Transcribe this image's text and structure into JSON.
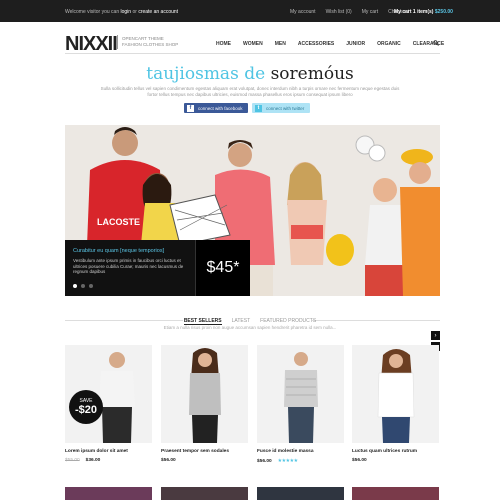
{
  "topbar": {
    "welcome_prefix": "Welcome visitor you can",
    "login": "login",
    "or": "or",
    "create": "create an account",
    "links": [
      "My account",
      "Wish list (0)",
      "My cart",
      "Checkout"
    ],
    "cart_label": "My cart",
    "cart_items": "1 item(s)",
    "cart_amount": "$250.00"
  },
  "header": {
    "logo": "NIXXII",
    "tagline_1": "OPENCART THEME",
    "tagline_2": "FASHION CLOTHES SHOP",
    "nav": [
      "HOME",
      "WOMEN",
      "MEN",
      "ACCESSORIES",
      "JUNIOR",
      "ORGANIC",
      "CLEARANCE"
    ]
  },
  "intro": {
    "title_1": "taujiosmas de",
    "title_2": "soremóus",
    "subtitle": "Sulla sollicitudin tellus vel sapien condimentum egestas aliquam erat volutpat, donec interdum nibh a turpis ornare nec fermentum neque egestas duis fortor tellus tempus nec dapibus ultricies, euismod massa phasellus eros ipsum consequat ipsum libero",
    "facebook_btn": "connect with facebook",
    "twitter_btn": "connect with twitter"
  },
  "slider": {
    "caption_title": "Curabitur eu quam [neque temporios]",
    "caption_text": "Vestibulum ante ipsum primis in faucibus orci luctus et ultrices posuere cubilia Curae; mauris nec lacusmus de regnum dapibus",
    "price": "$45*",
    "brand_mark": "LACOSTE",
    "dots": 3,
    "active_dot": 1
  },
  "products_section": {
    "tabs": [
      "BEST SELLERS",
      "LATEST",
      "FEATURED PRODUCTS"
    ],
    "active_tab": 0,
    "subtitle": "Etiam a nulla risus proin non augue accumsan sapien hendrerit pharetra id sem nulla..."
  },
  "products": [
    {
      "name": "Lorem ipsum dolor sit amet",
      "old_price": "$55.00",
      "price": "$36.00",
      "sale_label": "SAVE",
      "sale_value": "-$20",
      "shirt": "#f4f4f4",
      "pants": "#2b2b2b"
    },
    {
      "name": "Praesent tempor sem sodales",
      "old_price": "",
      "price": "$56.00",
      "shirt": "#bfbfbf",
      "pants": "#222222"
    },
    {
      "name": "Fusce id molestie massa",
      "old_price": "",
      "price": "$56.00",
      "rating": "★★★★★",
      "shirt": "#cfcfcf",
      "pants": "#3a4a5e"
    },
    {
      "name": "Luctus quam ultrices rutrum",
      "old_price": "",
      "price": "$56.00",
      "shirt": "#ffffff",
      "pants": "#304870"
    }
  ],
  "colors": {
    "accent": "#4fc4e3",
    "dark": "#1e1e1e",
    "facebook": "#3b5998",
    "twitter": "#aee3f5"
  }
}
